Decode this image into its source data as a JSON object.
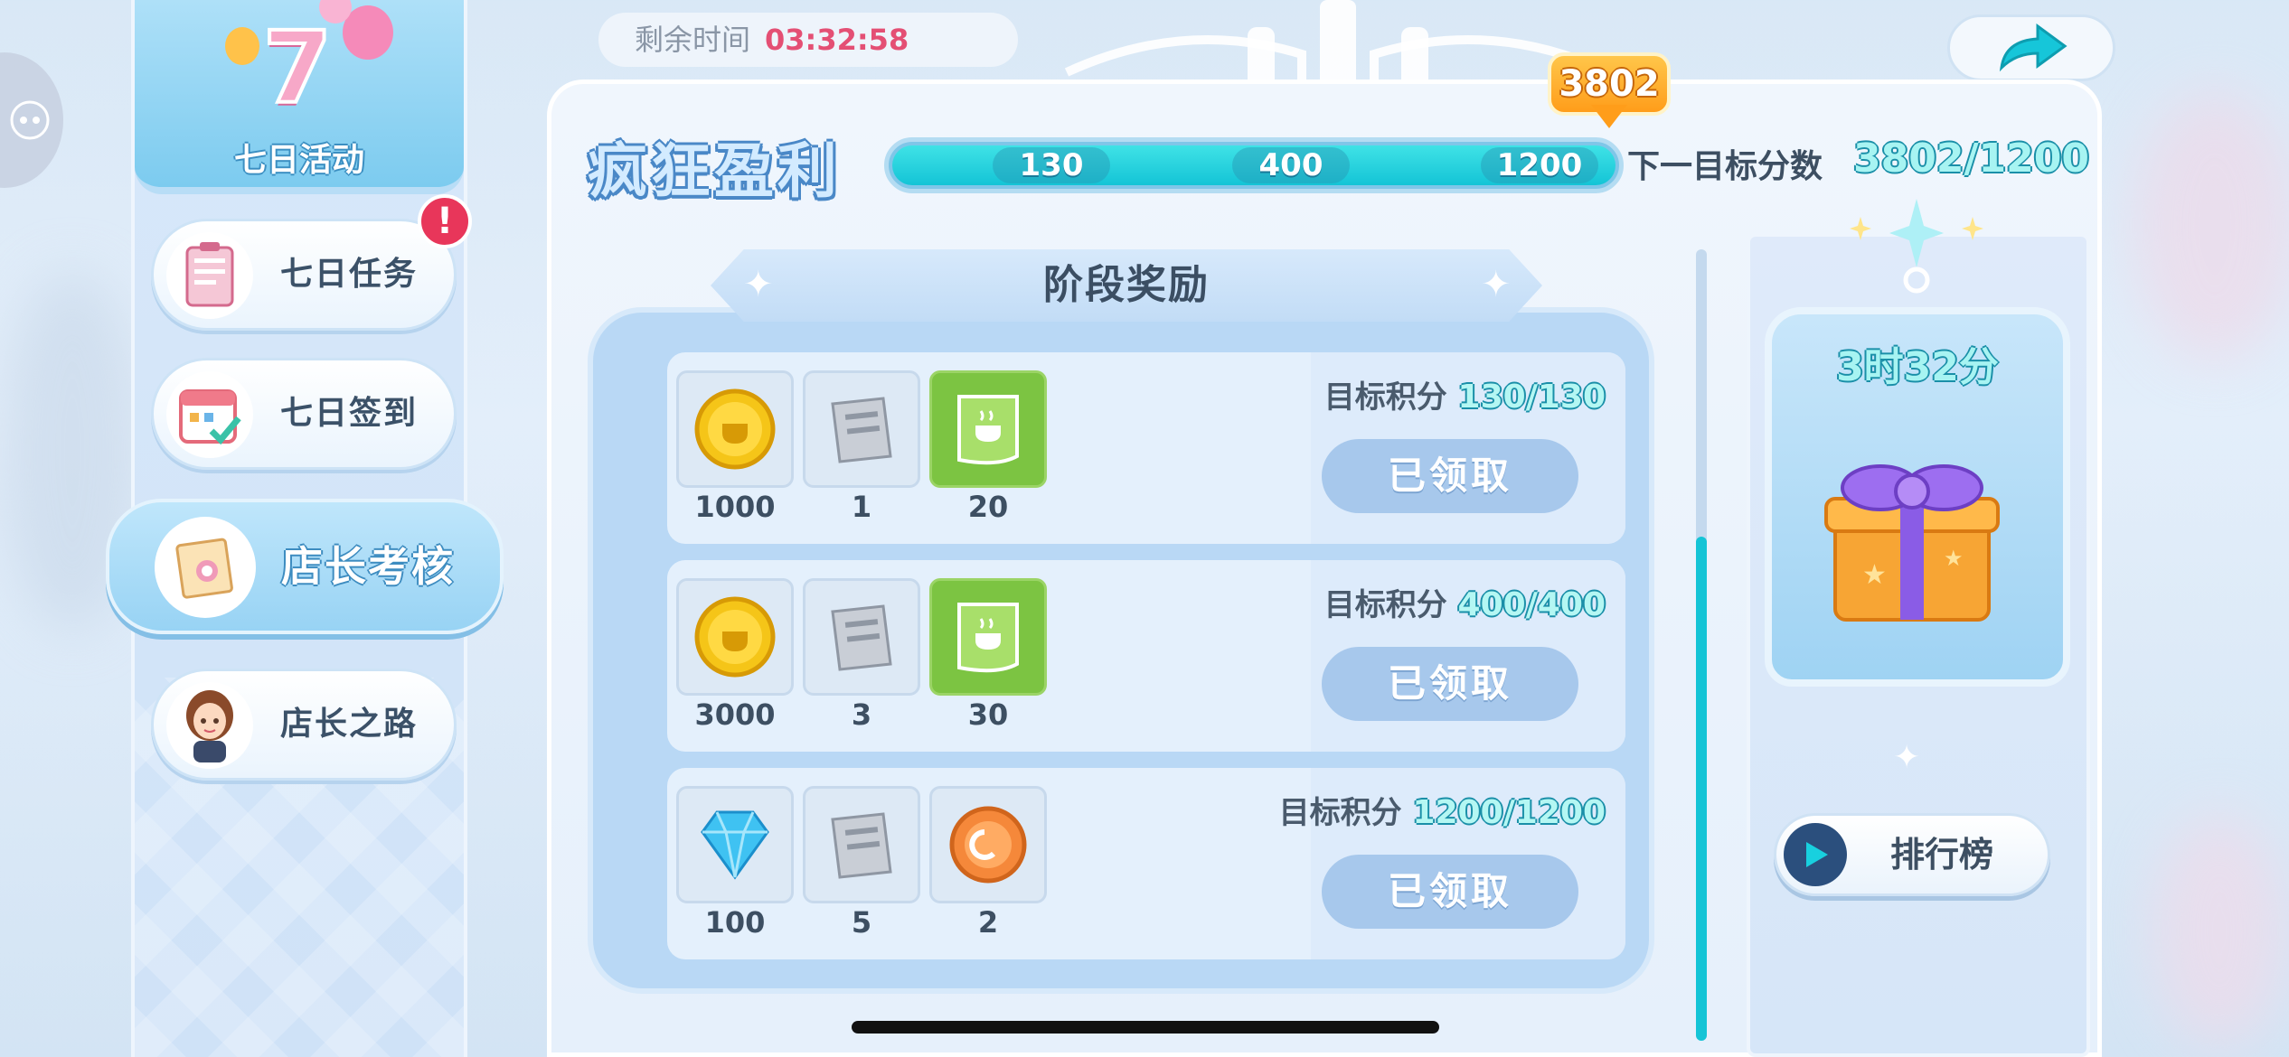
{
  "timer": {
    "label": "剩余时间",
    "value": "03:32:58"
  },
  "sidebar": {
    "event_title": "七日活动",
    "items": [
      {
        "label": "七日任务",
        "has_alert": true,
        "alert": "!"
      },
      {
        "label": "七日签到"
      },
      {
        "label": "店长考核",
        "active": true
      },
      {
        "label": "店长之路"
      }
    ]
  },
  "header": {
    "title": "疯狂盈利",
    "current_score": "3802",
    "milestones": [
      "130",
      "400",
      "1200"
    ],
    "progress_fraction": 1.0,
    "next_target_label": "下一目标分数",
    "next_target_value": "3802/1200"
  },
  "rewards": {
    "section_title": "阶段奖励",
    "tiers": [
      {
        "target_label": "目标积分",
        "target_value": "130/130",
        "button": "已领取",
        "items": [
          {
            "icon": "gold-coin-icon",
            "count": "1000"
          },
          {
            "icon": "newspaper-icon",
            "count": "1"
          },
          {
            "icon": "green-recipe-scroll-icon",
            "count": "20"
          }
        ]
      },
      {
        "target_label": "目标积分",
        "target_value": "400/400",
        "button": "已领取",
        "items": [
          {
            "icon": "gold-coin-icon",
            "count": "3000"
          },
          {
            "icon": "newspaper-icon",
            "count": "3"
          },
          {
            "icon": "green-recipe-scroll-icon",
            "count": "30"
          }
        ]
      },
      {
        "target_label": "目标积分",
        "target_value": "1200/1200",
        "button": "已领取",
        "items": [
          {
            "icon": "blue-diamond-icon",
            "count": "100"
          },
          {
            "icon": "newspaper-icon",
            "count": "5"
          },
          {
            "icon": "orange-token-icon",
            "count": "2"
          }
        ]
      }
    ]
  },
  "gift": {
    "time_left": "3时32分"
  },
  "rank_button": {
    "label": "排行榜"
  },
  "colors": {
    "accent_cyan": "#14c4d6",
    "timer_red": "#e44f74",
    "score_orange": "#ff9d1a",
    "claimed_button": "#a7c8ec"
  }
}
